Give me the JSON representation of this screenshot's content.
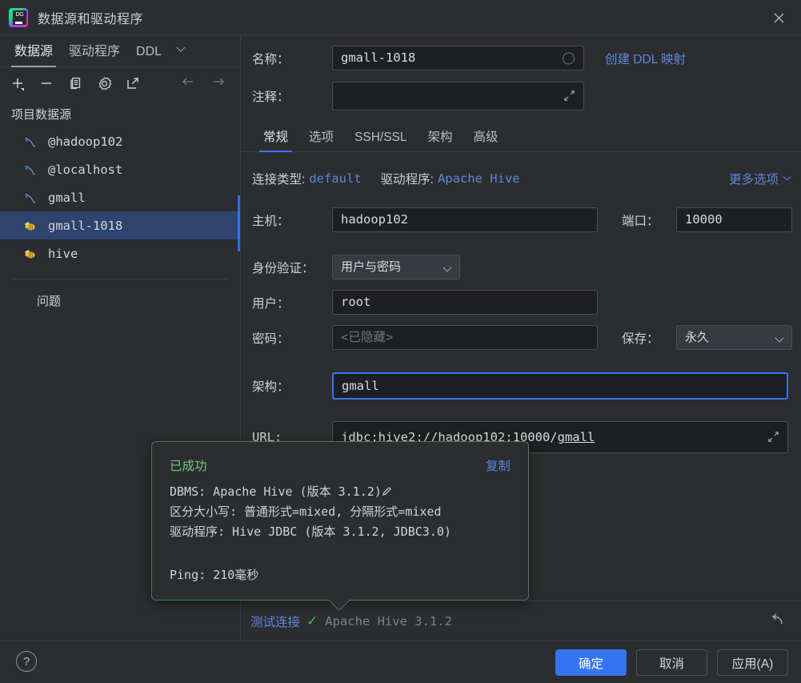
{
  "window": {
    "title": "数据源和驱动程序",
    "logo_text": "DG",
    "close_icon": "close-icon"
  },
  "sidebar": {
    "tabs": [
      {
        "label": "数据源",
        "active": true
      },
      {
        "label": "驱动程序",
        "active": false
      },
      {
        "label": "DDL",
        "active": false
      }
    ],
    "toolbar": [
      {
        "name": "add-icon",
        "tooltip": "添加"
      },
      {
        "name": "remove-icon",
        "tooltip": "移除"
      },
      {
        "name": "duplicate-icon",
        "tooltip": "复制"
      },
      {
        "name": "settings-gear-icon",
        "tooltip": "设置"
      },
      {
        "name": "external-link-icon",
        "tooltip": "打开"
      }
    ],
    "nav": [
      {
        "name": "back-arrow-icon"
      },
      {
        "name": "forward-arrow-icon"
      }
    ],
    "group_header": "项目数据源",
    "items": [
      {
        "label": "@hadoop102",
        "icon": "mysql-dolphin-icon",
        "selected": false
      },
      {
        "label": "@localhost",
        "icon": "mysql-dolphin-icon",
        "selected": false
      },
      {
        "label": "gmall",
        "icon": "mysql-dolphin-icon",
        "selected": false
      },
      {
        "label": "gmall-1018",
        "icon": "hive-bee-icon",
        "selected": true
      },
      {
        "label": "hive",
        "icon": "hive-bee-icon",
        "selected": false
      }
    ],
    "problems_label": "问题"
  },
  "form": {
    "name_label": "名称：",
    "name_value": "gmall-1018",
    "comment_label": "注释：",
    "comment_value": "",
    "create_ddl_mapping_link": "创建 DDL 映射",
    "tabs": [
      {
        "label": "常规",
        "active": true
      },
      {
        "label": "选项",
        "active": false
      },
      {
        "label": "SSH/SSL",
        "active": false
      },
      {
        "label": "架构",
        "active": false
      },
      {
        "label": "高级",
        "active": false
      }
    ],
    "conn_type_label": "连接类型:",
    "conn_type_value": "default",
    "driver_label": "驱动程序:",
    "driver_value": "Apache Hive",
    "more_options_link": "更多选项",
    "host_label": "主机：",
    "host_value": "hadoop102",
    "port_label": "端口：",
    "port_value": "10000",
    "auth_label": "身份验证：",
    "auth_value": "用户与密码",
    "user_label": "用户：",
    "user_value": "root",
    "password_label": "密码：",
    "password_placeholder": "<已隐藏>",
    "save_label": "保存：",
    "save_value": "永久",
    "schema_label": "架构：",
    "schema_value": "gmall",
    "url_label": "URL:",
    "url_value": "jdbc:hive2://hadoop102:10000/",
    "url_value_link": "gmall"
  },
  "popup": {
    "status": "已成功",
    "copy_link": "复制",
    "line1": "DBMS: Apache Hive (版本 3.1.2)",
    "line2": "区分大小写: 普通形式=mixed, 分隔形式=mixed",
    "line3": "驱动程序: Hive JDBC (版本 3.1.2, JDBC3.0)",
    "ping": "Ping: 210毫秒",
    "edit_icon": "pencil-icon",
    "border_color": "#4a7a55"
  },
  "test_strip": {
    "test_link": "测试连接",
    "check_icon": "check-mark-icon",
    "result": "Apache Hive 3.1.2",
    "revert_icon": "revert-arrow-icon"
  },
  "footer": {
    "help_icon": "question-mark-icon",
    "ok_label": "确定",
    "cancel_label": "取消",
    "apply_label": "应用(A)"
  },
  "colors": {
    "background": "#2b2d30",
    "input_background": "#1e1f22",
    "selection": "#2e436e",
    "accent_blue": "#3574f0",
    "link_blue": "#5d87da",
    "success_green": "#79c67b",
    "border": "#393b40"
  }
}
